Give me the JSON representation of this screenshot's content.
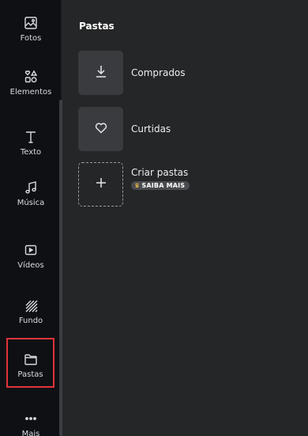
{
  "sidebar": {
    "items": [
      {
        "label": "Fotos",
        "icon": "image-icon"
      },
      {
        "label": "Elementos",
        "icon": "shapes-icon"
      },
      {
        "label": "Texto",
        "icon": "text-icon"
      },
      {
        "label": "Música",
        "icon": "music-note-icon"
      },
      {
        "label": "Vídeos",
        "icon": "video-play-icon"
      },
      {
        "label": "Fundo",
        "icon": "background-pattern-icon"
      },
      {
        "label": "Pastas",
        "icon": "folder-icon",
        "active": true
      },
      {
        "label": "Mais",
        "icon": "more-dots-icon"
      }
    ]
  },
  "panel": {
    "title": "Pastas",
    "folders": [
      {
        "label": "Comprados",
        "icon": "download-icon"
      },
      {
        "label": "Curtidas",
        "icon": "heart-icon"
      },
      {
        "label": "Criar pastas",
        "icon": "plus-icon",
        "badge": "SAIBA MAIS"
      }
    ]
  },
  "colors": {
    "rail_bg": "#0e1014",
    "panel_bg": "#252627",
    "active_outline": "#e0343a",
    "crown": "#f6c545"
  }
}
